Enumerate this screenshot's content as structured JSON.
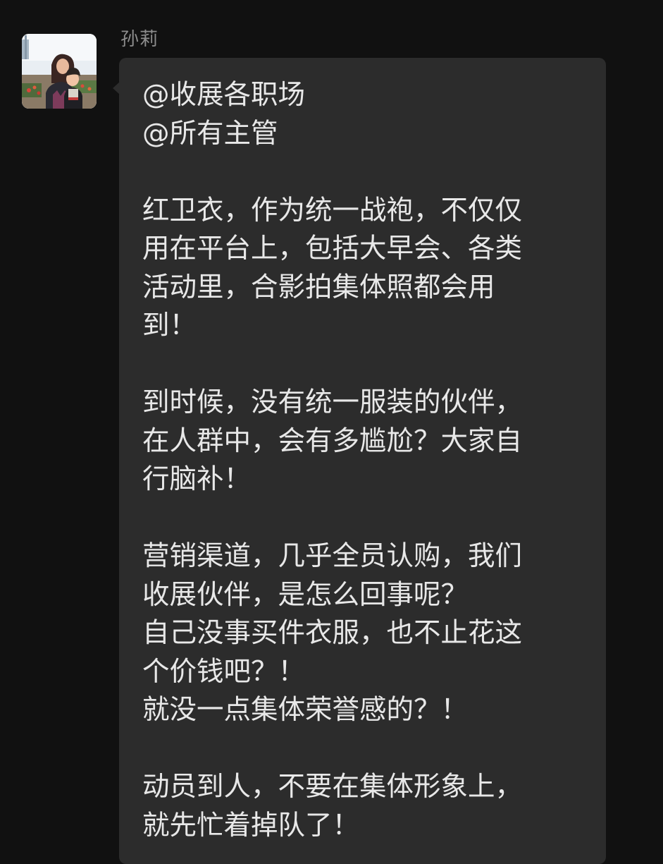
{
  "sender": {
    "name": "孙莉",
    "avatar": "avatar-photo"
  },
  "message": {
    "text": "@收展各职场\n@所有主管\n\n红卫衣，作为统一战袍，不仅仅\n用在平台上，包括大早会、各类\n活动里，合影拍集体照都会用\n到！\n\n到时候，没有统一服装的伙伴，\n在人群中，会有多尴尬？大家自\n行脑补！\n\n营销渠道，几乎全员认购，我们\n收展伙伴，是怎么回事呢？\n自己没事买件衣服，也不止花这\n个价钱吧？！\n就没一点集体荣誉感的？！\n\n动员到人，不要在集体形象上，\n就先忙着掉队了！"
  },
  "colors": {
    "background": "#111111",
    "bubble": "#2c2c2c",
    "text": "#e8e8e8",
    "sender_name": "#8d8d8d"
  }
}
